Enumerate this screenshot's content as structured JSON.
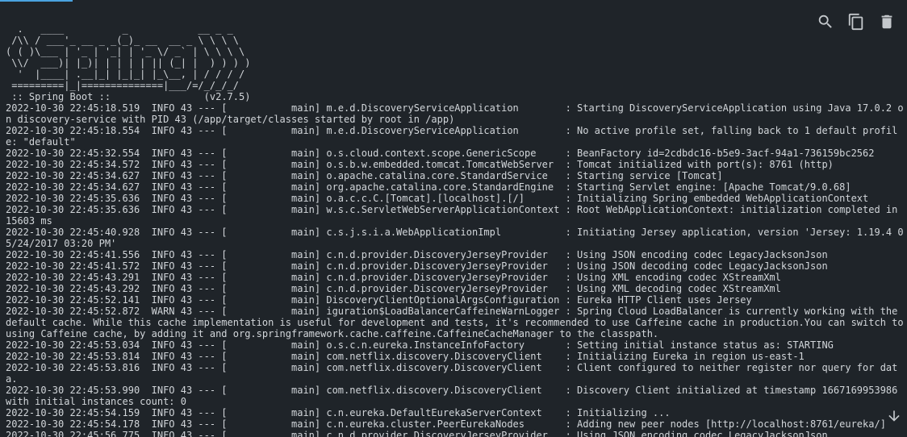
{
  "console": {
    "banner": "  .   ____          _            __ _ _\n /\\\\ / ___'_ __ _ _(_)_ __  __ _ \\ \\ \\ \\\n( ( )\\___ | '_ | '_| | '_ \\/ _` | \\ \\ \\ \\\n \\\\/  ___)| |_)| | | | | || (_| |  ) ) ) )\n  '  |____| .__|_| |_|_| |_\\__, | / / / /\n =========|_|==============|___/=/_/_/_/\n :: Spring Boot ::                (v2.7.5)\n",
    "log": "2022-10-30 22:45:18.519  INFO 43 --- [           main] m.e.d.DiscoveryServiceApplication        : Starting DiscoveryServiceApplication using Java 17.0.2 on discovery-service with PID 43 (/app/target/classes started by root in /app)\n2022-10-30 22:45:18.554  INFO 43 --- [           main] m.e.d.DiscoveryServiceApplication        : No active profile set, falling back to 1 default profile: \"default\"\n2022-10-30 22:45:32.554  INFO 43 --- [           main] o.s.cloud.context.scope.GenericScope     : BeanFactory id=2cdbdc16-b5e9-3acf-94a1-736159bc2562\n2022-10-30 22:45:34.572  INFO 43 --- [           main] o.s.b.w.embedded.tomcat.TomcatWebServer  : Tomcat initialized with port(s): 8761 (http)\n2022-10-30 22:45:34.627  INFO 43 --- [           main] o.apache.catalina.core.StandardService   : Starting service [Tomcat]\n2022-10-30 22:45:34.627  INFO 43 --- [           main] org.apache.catalina.core.StandardEngine  : Starting Servlet engine: [Apache Tomcat/9.0.68]\n2022-10-30 22:45:35.636  INFO 43 --- [           main] o.a.c.c.C.[Tomcat].[localhost].[/]       : Initializing Spring embedded WebApplicationContext\n2022-10-30 22:45:35.636  INFO 43 --- [           main] w.s.c.ServletWebServerApplicationContext : Root WebApplicationContext: initialization completed in 15603 ms\n2022-10-30 22:45:40.928  INFO 43 --- [           main] c.s.j.s.i.a.WebApplicationImpl           : Initiating Jersey application, version 'Jersey: 1.19.4 05/24/2017 03:20 PM'\n2022-10-30 22:45:41.556  INFO 43 --- [           main] c.n.d.provider.DiscoveryJerseyProvider   : Using JSON encoding codec LegacyJacksonJson\n2022-10-30 22:45:41.572  INFO 43 --- [           main] c.n.d.provider.DiscoveryJerseyProvider   : Using JSON decoding codec LegacyJacksonJson\n2022-10-30 22:45:43.291  INFO 43 --- [           main] c.n.d.provider.DiscoveryJerseyProvider   : Using XML encoding codec XStreamXml\n2022-10-30 22:45:43.292  INFO 43 --- [           main] c.n.d.provider.DiscoveryJerseyProvider   : Using XML decoding codec XStreamXml\n2022-10-30 22:45:52.141  INFO 43 --- [           main] DiscoveryClientOptionalArgsConfiguration : Eureka HTTP Client uses Jersey\n2022-10-30 22:45:52.872  WARN 43 --- [           main] iguration$LoadBalancerCaffeineWarnLogger : Spring Cloud LoadBalancer is currently working with the default cache. While this cache implementation is useful for development and tests, it's recommended to use Caffeine cache in production.You can switch to using Caffeine cache, by adding it and org.springframework.cache.caffeine.CaffeineCacheManager to the classpath.\n2022-10-30 22:45:53.034  INFO 43 --- [           main] o.s.c.n.eureka.InstanceInfoFactory       : Setting initial instance status as: STARTING\n2022-10-30 22:45:53.814  INFO 43 --- [           main] com.netflix.discovery.DiscoveryClient    : Initializing Eureka in region us-east-1\n2022-10-30 22:45:53.816  INFO 43 --- [           main] com.netflix.discovery.DiscoveryClient    : Client configured to neither register nor query for data.\n2022-10-30 22:45:53.990  INFO 43 --- [           main] com.netflix.discovery.DiscoveryClient    : Discovery Client initialized at timestamp 1667169953986 with initial instances count: 0\n2022-10-30 22:45:54.159  INFO 43 --- [           main] c.n.eureka.DefaultEurekaServerContext    : Initializing ...\n2022-10-30 22:45:54.178  INFO 43 --- [           main] c.n.eureka.cluster.PeerEurekaNodes       : Adding new peer nodes [http://localhost:8761/eureka/]\n2022-10-30 22:45:56.775  INFO 43 --- [           main] c.n.d.provider.DiscoveryJerseyProvider   : Using JSON encoding codec LegacyJacksonJson"
  },
  "toolbar": {
    "search_icon": "search-icon",
    "copy_icon": "copy-icon",
    "delete_icon": "trash-icon",
    "scroll_icon": "arrow-down-icon"
  },
  "colors": {
    "background": "#1f2429",
    "text": "#d2d6da",
    "icon": "#c4c8cc",
    "accent": "#4aa3e0"
  }
}
